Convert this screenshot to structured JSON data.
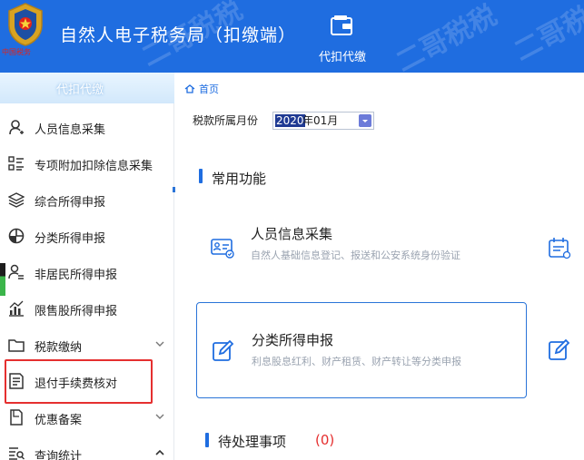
{
  "header": {
    "app_title": "自然人电子税务局（扣缴端）",
    "emblem_text": "中国税务",
    "nav_item": {
      "label": "代扣代缴",
      "icon": "wallet-icon"
    },
    "watermarks": [
      "二哥税税",
      "二哥税税",
      "二哥税税"
    ]
  },
  "sidebar": {
    "header_label": "代扣代缴",
    "items": [
      {
        "label": "人员信息采集",
        "icon": "person-icon"
      },
      {
        "label": "专项附加扣除信息采集",
        "icon": "list-icon"
      },
      {
        "label": "综合所得申报",
        "icon": "layers-icon"
      },
      {
        "label": "分类所得申报",
        "icon": "pie-chart-icon"
      },
      {
        "label": "非居民所得申报",
        "icon": "person-card-icon"
      },
      {
        "label": "限售股所得申报",
        "icon": "bar-chart-icon"
      },
      {
        "label": "税款缴纳",
        "icon": "folder-icon",
        "expandable": true
      },
      {
        "label": "退付手续费核对",
        "icon": "document-icon",
        "highlighted": true
      },
      {
        "label": "优惠备案",
        "icon": "file-icon",
        "expandable": true
      },
      {
        "label": "查询统计",
        "icon": "query-list-icon",
        "expandable": true,
        "expanded": true
      }
    ],
    "highlight_color": "#e52f2f"
  },
  "breadcrumb": {
    "home": "首页"
  },
  "tax_month": {
    "label": "税款所属月份",
    "year": "2020",
    "rest": "年01月"
  },
  "common_functions": {
    "title": "常用功能",
    "cards": [
      {
        "title": "人员信息采集",
        "desc": "自然人基础信息登记、报送和公安系统身份验证",
        "icon": "id-card-icon",
        "right_icon": "calendar-tax-icon"
      },
      {
        "title": "分类所得申报",
        "desc": "利息股息红利、财产租赁、财产转让等分类申报",
        "icon": "edit-icon",
        "right_icon": "edit-icon",
        "active": true
      }
    ]
  },
  "pending": {
    "title": "待处理事项",
    "count": "(0)"
  },
  "colors": {
    "primary": "#1f6de0",
    "accent_red": "#e52f2f",
    "desc_gray": "#9aa3b0"
  }
}
